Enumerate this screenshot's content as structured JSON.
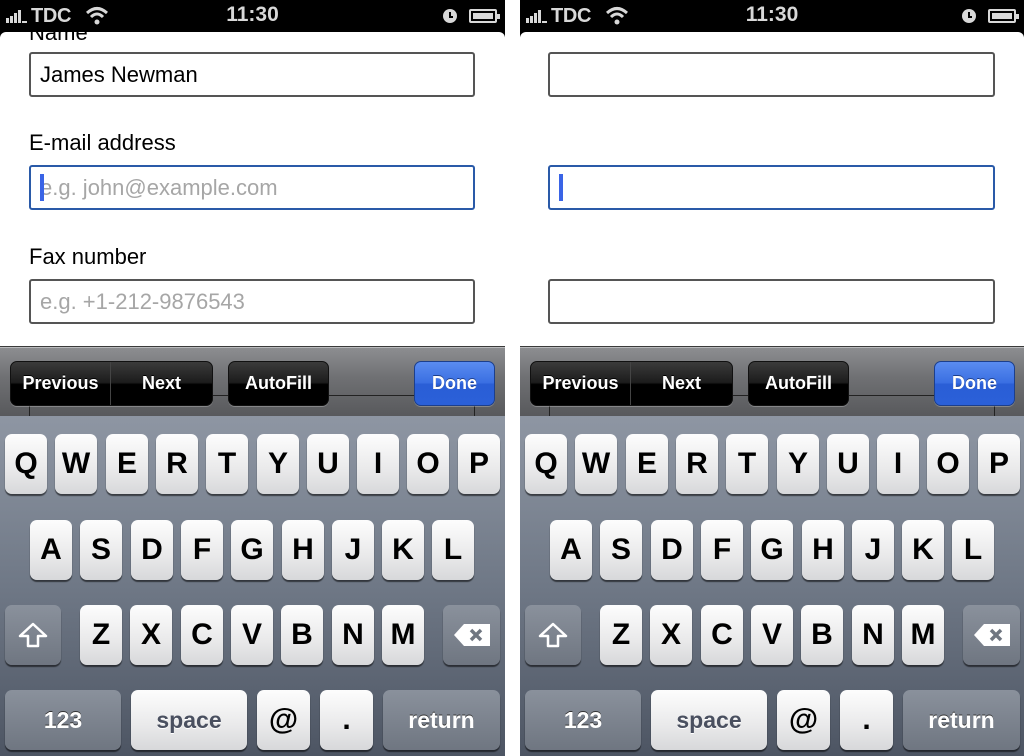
{
  "screens": [
    {
      "id": "left",
      "status_bar": {
        "carrier": "TDC",
        "time": "11:30",
        "icons": [
          "signal-icon",
          "wifi-icon",
          "clock-icon",
          "battery-icon"
        ]
      },
      "form": {
        "fields": [
          {
            "label": "Name",
            "value": "James Newman",
            "placeholder": "",
            "focused": false
          },
          {
            "label": "E-mail address",
            "value": "",
            "placeholder": "e.g. john@example.com",
            "focused": true
          },
          {
            "label": "Fax number",
            "value": "",
            "placeholder": "e.g. +1-212-9876543",
            "focused": false
          }
        ]
      },
      "toolbar": {
        "previous": "Previous",
        "next": "Next",
        "autofill": "AutoFill",
        "done": "Done"
      },
      "keyboard": {
        "row1": [
          "Q",
          "W",
          "E",
          "R",
          "T",
          "Y",
          "U",
          "I",
          "O",
          "P"
        ],
        "row2": [
          "A",
          "S",
          "D",
          "F",
          "G",
          "H",
          "J",
          "K",
          "L"
        ],
        "row3": [
          "Z",
          "X",
          "C",
          "V",
          "B",
          "N",
          "M"
        ],
        "row4": {
          "numbers": "123",
          "space": "space",
          "at": "@",
          "dot": ".",
          "return": "return"
        },
        "shift_icon": "shift-icon",
        "delete_icon": "delete-icon"
      }
    },
    {
      "id": "right",
      "status_bar": {
        "carrier": "TDC",
        "time": "11:30",
        "icons": [
          "signal-icon",
          "wifi-icon",
          "clock-icon",
          "battery-icon"
        ]
      },
      "form": {
        "fields": [
          {
            "label": "",
            "value": "",
            "placeholder": "",
            "focused": false
          },
          {
            "label": "",
            "value": "",
            "placeholder": "",
            "focused": true
          },
          {
            "label": "",
            "value": "",
            "placeholder": "",
            "focused": false
          }
        ]
      },
      "toolbar": {
        "previous": "Previous",
        "next": "Next",
        "autofill": "AutoFill",
        "done": "Done"
      },
      "keyboard": {
        "row1": [
          "Q",
          "W",
          "E",
          "R",
          "T",
          "Y",
          "U",
          "I",
          "O",
          "P"
        ],
        "row2": [
          "A",
          "S",
          "D",
          "F",
          "G",
          "H",
          "J",
          "K",
          "L"
        ],
        "row3": [
          "Z",
          "X",
          "C",
          "V",
          "B",
          "N",
          "M"
        ],
        "row4": {
          "numbers": "123",
          "space": "space",
          "at": "@",
          "dot": ".",
          "return": "return"
        },
        "shift_icon": "shift-icon",
        "delete_icon": "delete-icon"
      }
    }
  ],
  "colors": {
    "done_button": "#2f63dc",
    "caret": "#3a64e6",
    "focused_border": "#2a5aa8",
    "placeholder": "#a6a6a6"
  }
}
